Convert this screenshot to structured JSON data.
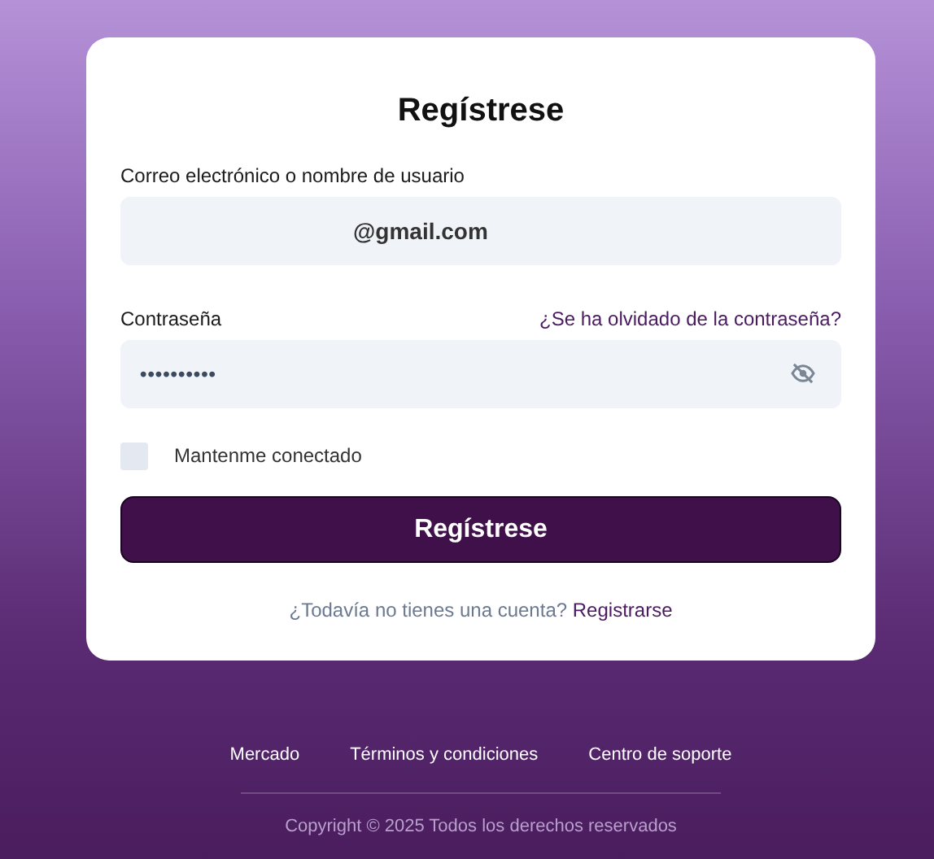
{
  "form": {
    "title": "Regístrese",
    "email": {
      "label": "Correo electrónico o nombre de usuario",
      "value": "@gmail.com"
    },
    "password": {
      "label": "Contraseña",
      "forgot_link": "¿Se ha olvidado de la contraseña?",
      "value": "••••••••••",
      "visible": false
    },
    "remember": {
      "label": "Mantenme conectado",
      "checked": false
    },
    "submit": "Regístrese",
    "signup_prompt": "¿Todavía no tienes una cuenta?",
    "signup_link": "Registrarse"
  },
  "footer": {
    "links": [
      "Mercado",
      "Términos y condiciones",
      "Centro de soporte"
    ],
    "copyright": "Copyright © 2025 Todos los derechos reservados"
  }
}
